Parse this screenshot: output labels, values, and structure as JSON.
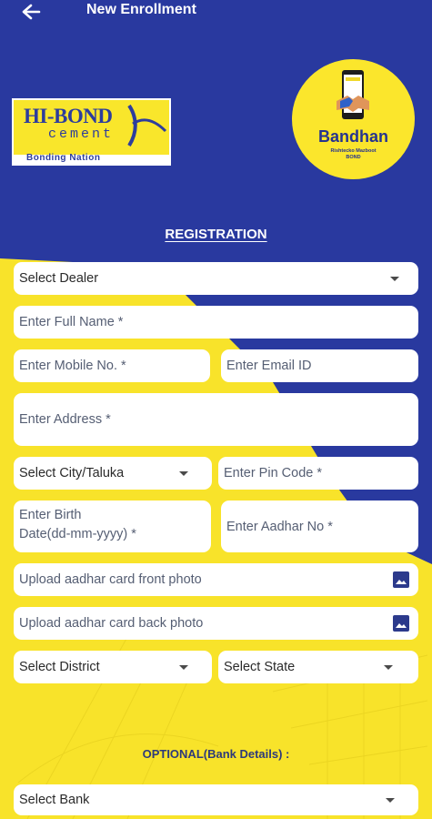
{
  "header": {
    "title": "New Enrollment",
    "back_icon": "arrow-left-icon"
  },
  "brand": {
    "name": "HI-BOND",
    "sub": "cement",
    "tagline": "Bonding Nation"
  },
  "badge": {
    "name": "Bandhan",
    "tagline": "Rishtecko Mazboot",
    "tagline2": "BOND",
    "icon": "phone-handshake-icon"
  },
  "form": {
    "heading": "REGISTRATION",
    "select_dealer": "Select Dealer",
    "full_name_placeholder": "Enter Full Name *",
    "mobile_placeholder": "Enter Mobile No. *",
    "email_placeholder": "Enter Email ID",
    "address_placeholder": "Enter Address *",
    "city_select": "Select City/Taluka",
    "pin_placeholder": "Enter Pin Code *",
    "birth_line1": "Enter Birth",
    "birth_line2": "Date(dd-mm-yyyy) *",
    "aadhar_placeholder": "Enter Aadhar No *",
    "upload_front": "Upload aadhar card front photo",
    "upload_back": "Upload aadhar card back photo",
    "district_select": "Select District",
    "state_select": "Select State",
    "optional_heading": "OPTIONAL(Bank Details) :",
    "bank_select": "Select Bank"
  },
  "colors": {
    "primary_blue": "#29399f",
    "brand_yellow": "#f9e62b",
    "field_bg": "#ffffff"
  }
}
